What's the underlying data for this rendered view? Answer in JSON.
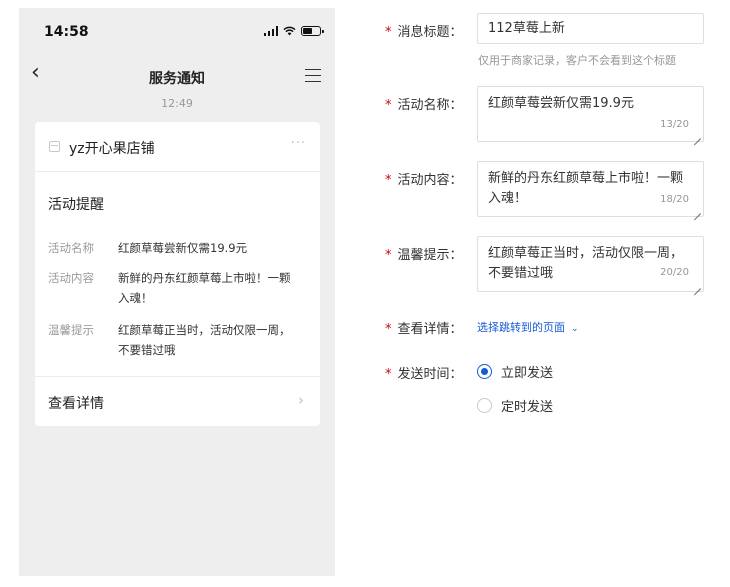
{
  "phone": {
    "status_time": "14:58",
    "nav_title": "服务通知",
    "message_time": "12:49",
    "card": {
      "shop_name": "yz开心果店铺",
      "more_glyph": "···",
      "remind_title": "活动提醒",
      "rows": [
        {
          "key": "活动名称",
          "value": "红颜草莓尝新仅需19.9元"
        },
        {
          "key": "活动内容",
          "value": "新鲜的丹东红颜草莓上市啦！一颗入魂！"
        },
        {
          "key": "温馨提示",
          "value": "红颜草莓正当时，活动仅限一周，不要错过哦"
        }
      ],
      "footer_label": "查看详情",
      "footer_arrow": "›"
    },
    "icons": {
      "back": "chevron-left-icon",
      "menu": "hamburger-menu-icon",
      "shop": "shop-icon",
      "signal": "signal-icon",
      "wifi": "wifi-icon",
      "battery": "battery-icon"
    }
  },
  "form": {
    "required_mark": "*",
    "title": {
      "label": "消息标题：",
      "value": "112草莓上新",
      "help": "仅用于商家记录，客户不会看到这个标题"
    },
    "activity_name": {
      "label": "活动名称：",
      "value": "红颜草莓尝新仅需19.9元",
      "count": "13/20"
    },
    "activity_content": {
      "label": "活动内容：",
      "value": "新鲜的丹东红颜草莓上市啦！一颗入魂！",
      "count": "18/20"
    },
    "tip": {
      "label": "温馨提示：",
      "value": "红颜草莓正当时，活动仅限一周，不要错过哦",
      "count": "20/20"
    },
    "detail": {
      "label": "查看详情：",
      "link": "选择跳转到的页面",
      "chevron": "⌄"
    },
    "send_time": {
      "label": "发送时间：",
      "options": [
        {
          "label": "立即发送",
          "checked": true
        },
        {
          "label": "定时发送",
          "checked": false
        }
      ]
    }
  },
  "colors": {
    "accent": "#155bd4",
    "required": "#d40000",
    "phone_bg": "#eeeeee"
  }
}
